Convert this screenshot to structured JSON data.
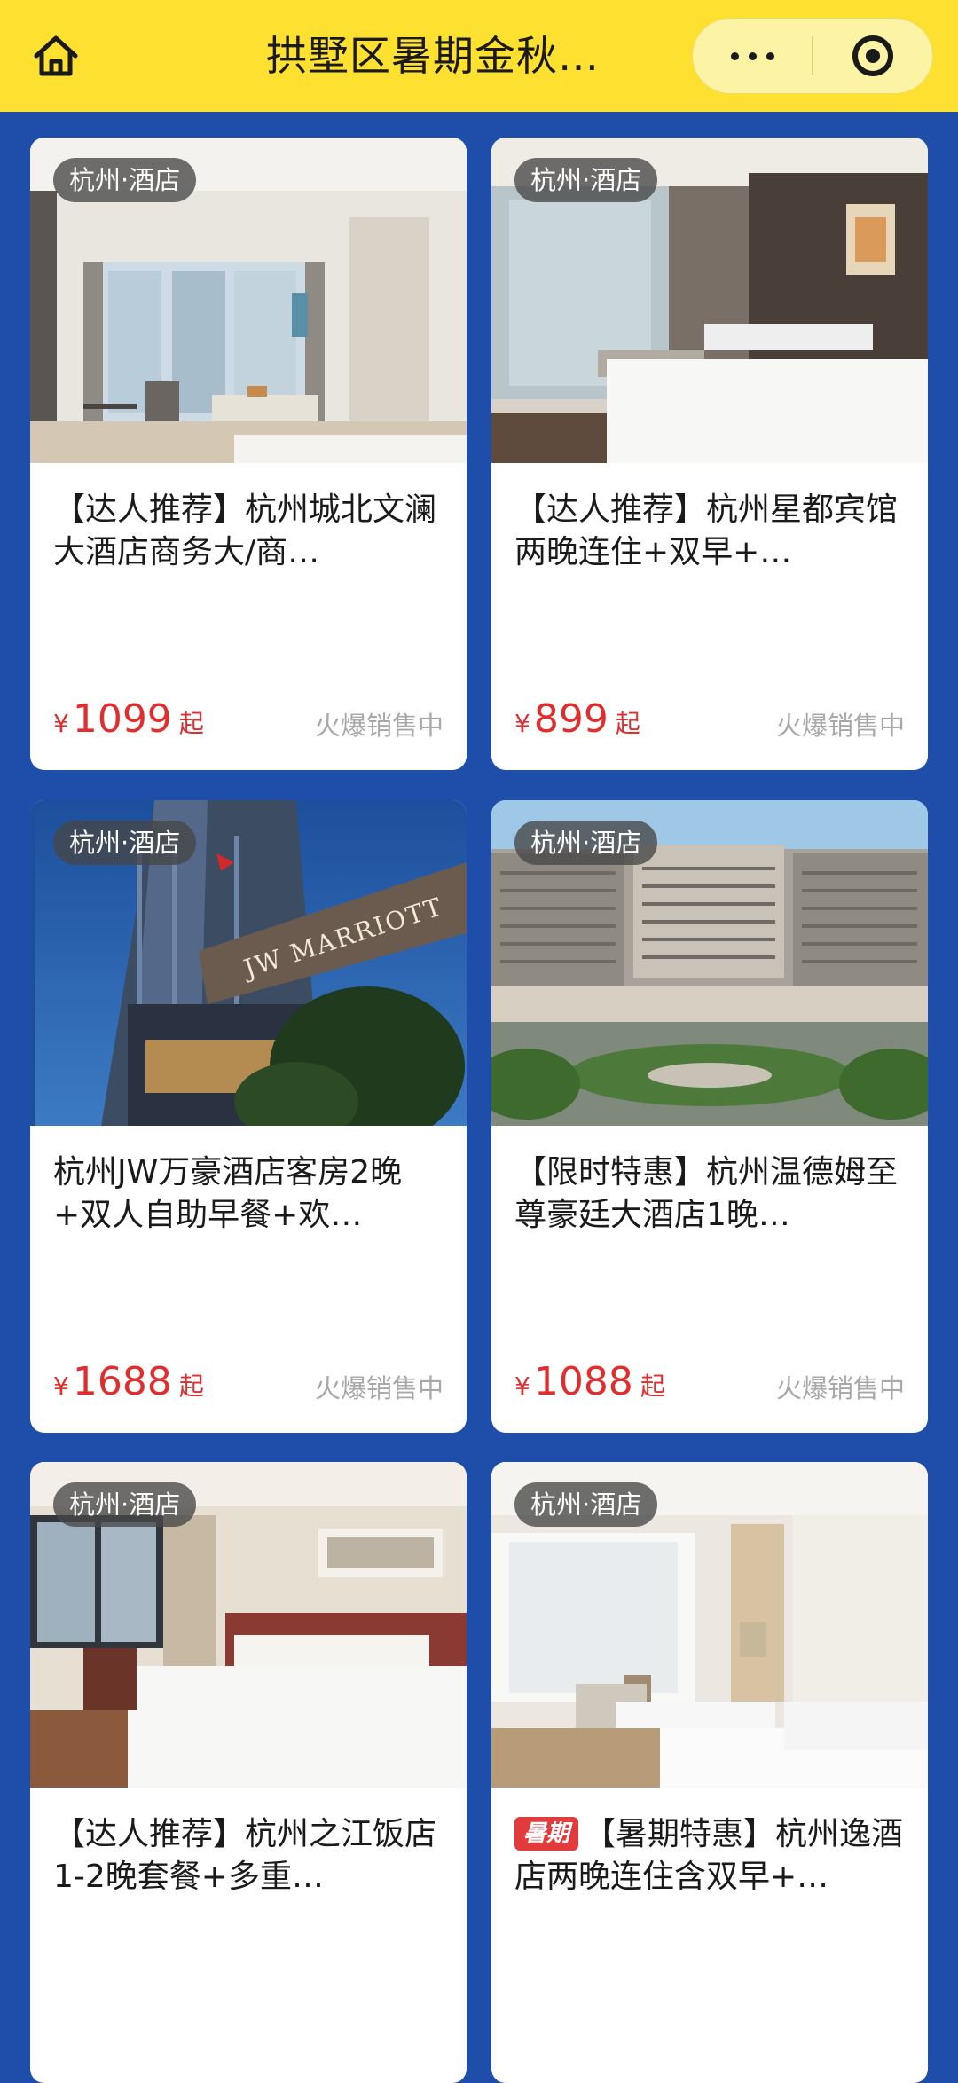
{
  "header": {
    "title": "拱墅区暑期金秋…",
    "home_icon": "home-icon",
    "more_icon": "more-dots-icon",
    "close_icon": "target-circle-icon",
    "bg_color": "#fde030"
  },
  "theme": {
    "page_bg": "#1f4eaa",
    "price_color": "#e02e2e",
    "status_color": "#a8a8a8"
  },
  "products": [
    {
      "tag": "杭州·酒店",
      "title": "【达人推荐】杭州城北文澜大酒店商务大/商…",
      "currency": "¥",
      "price": "1099",
      "price_suffix": "起",
      "status": "火爆销售中",
      "image": "hotel-room-window-photo"
    },
    {
      "tag": "杭州·酒店",
      "title": "【达人推荐】杭州星都宾馆两晚连住+双早+…",
      "currency": "¥",
      "price": "899",
      "price_suffix": "起",
      "status": "火爆销售中",
      "image": "hotel-bedroom-photo"
    },
    {
      "tag": "杭州·酒店",
      "title": "杭州JW万豪酒店客房2晚+双人自助早餐+欢…",
      "currency": "¥",
      "price": "1688",
      "price_suffix": "起",
      "status": "火爆销售中",
      "image": "jw-marriott-tower-photo",
      "image_sign_text": "JW MARRIOTT"
    },
    {
      "tag": "杭州·酒店",
      "title": "【限时特惠】杭州温德姆至尊豪廷大酒店1晚…",
      "currency": "¥",
      "price": "1088",
      "price_suffix": "起",
      "status": "火爆销售中",
      "image": "resort-building-aerial-photo"
    },
    {
      "tag": "杭州·酒店",
      "title": "【达人推荐】杭州之江饭店1-2晚套餐+多重…",
      "image": "twin-bed-room-photo"
    },
    {
      "tag": "杭州·酒店",
      "badge": "暑期",
      "title": "【暑期特惠】杭州逸酒店两晚连住含双早+…",
      "image": "bright-twin-room-photo"
    }
  ]
}
